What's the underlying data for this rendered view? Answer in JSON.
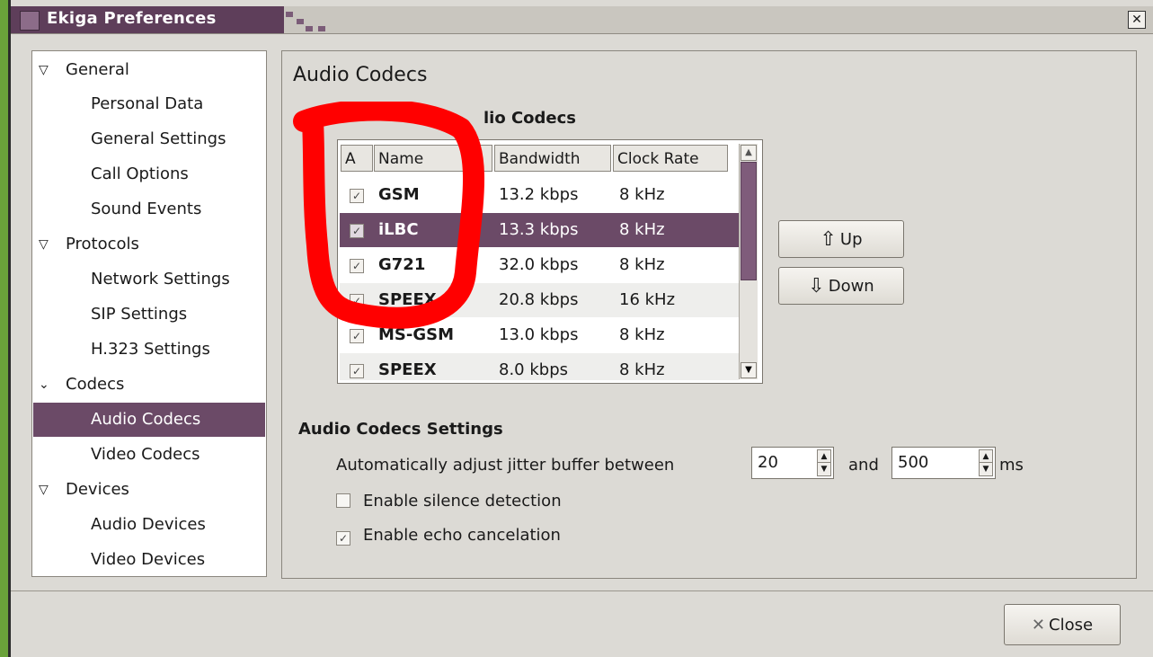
{
  "window": {
    "title": "Ekiga Preferences",
    "close_glyph": "✕"
  },
  "sidebar": {
    "items": [
      {
        "label": "General",
        "kind": "category"
      },
      {
        "label": "Personal Data",
        "kind": "page"
      },
      {
        "label": "General Settings",
        "kind": "page"
      },
      {
        "label": "Call Options",
        "kind": "page"
      },
      {
        "label": "Sound Events",
        "kind": "page"
      },
      {
        "label": "Protocols",
        "kind": "category"
      },
      {
        "label": "Network Settings",
        "kind": "page"
      },
      {
        "label": "SIP Settings",
        "kind": "page"
      },
      {
        "label": "H.323 Settings",
        "kind": "page"
      },
      {
        "label": "Codecs",
        "kind": "category"
      },
      {
        "label": "Audio Codecs",
        "kind": "page",
        "selected": true
      },
      {
        "label": "Video Codecs",
        "kind": "page"
      },
      {
        "label": "Devices",
        "kind": "category"
      },
      {
        "label": "Audio Devices",
        "kind": "page"
      },
      {
        "label": "Video Devices",
        "kind": "page"
      }
    ]
  },
  "main": {
    "title": "Audio Codecs",
    "available_section_title": "lio Codecs",
    "table": {
      "headers": [
        "A",
        "Name",
        "Bandwidth",
        "Clock Rate"
      ],
      "rows": [
        {
          "active": true,
          "name": "GSM",
          "bandwidth": "13.2 kbps",
          "clock_rate": "8 kHz"
        },
        {
          "active": true,
          "name": "iLBC",
          "bandwidth": "13.3 kbps",
          "clock_rate": "8 kHz",
          "selected": true
        },
        {
          "active": true,
          "name": "G721",
          "bandwidth": "32.0 kbps",
          "clock_rate": "8 kHz"
        },
        {
          "active": true,
          "name": "SPEEX",
          "bandwidth": "20.8 kbps",
          "clock_rate": "16 kHz"
        },
        {
          "active": true,
          "name": "MS-GSM",
          "bandwidth": "13.0 kbps",
          "clock_rate": "8 kHz"
        },
        {
          "active": true,
          "name": "SPEEX",
          "bandwidth": "8.0 kbps",
          "clock_rate": "8 kHz"
        }
      ]
    },
    "buttons": {
      "up_label": "Up",
      "down_label": "Down"
    },
    "settings": {
      "section_title": "Audio Codecs Settings",
      "jitter_label": "Automatically adjust jitter buffer between",
      "jitter_min": "20",
      "and_label": "and",
      "jitter_max": "500",
      "ms_label": "ms",
      "silence_label": "Enable silence detection",
      "silence_checked": false,
      "echo_label": "Enable echo cancelation",
      "echo_checked": true
    }
  },
  "footer": {
    "close_label": "Close"
  },
  "colors": {
    "selection": "#6b4a67",
    "title_bar": "#5e3e5a",
    "annotation": "#ff0000"
  },
  "icons": {
    "arrow_up": "⇧",
    "arrow_down": "⇩",
    "close": "✕",
    "check": "✓"
  }
}
